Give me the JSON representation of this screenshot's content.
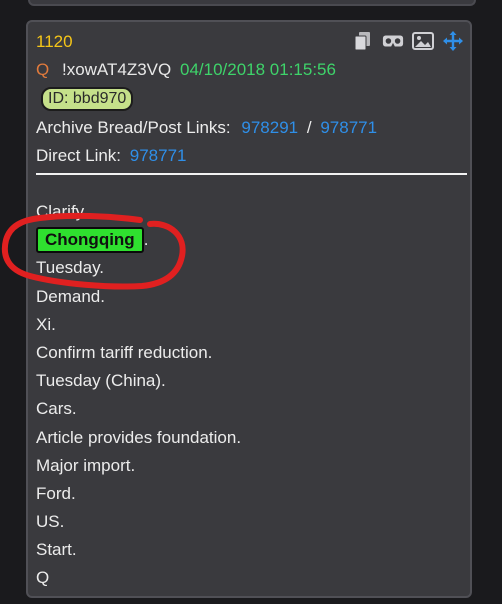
{
  "post": {
    "number": "1120",
    "q_mark": "Q",
    "tripcode": "!xowAT4Z3VQ",
    "timestamp": "04/10/2018 01:15:56",
    "id_badge": "ID: bbd970",
    "archive_label": "Archive Bread/Post Links:",
    "archive_link_1": "978291",
    "archive_sep": "/",
    "archive_link_2": "978771",
    "direct_label": "Direct Link:",
    "direct_link": "978771"
  },
  "body": {
    "lines": [
      "Clarify.",
      "Chongqing",
      "Tuesday.",
      "Demand.",
      "Xi.",
      "Confirm tariff reduction.",
      "Tuesday (China).",
      "Cars.",
      "Article provides foundation.",
      "Major import.",
      "Ford.",
      "US.",
      "Start.",
      "Q"
    ],
    "highlight_suffix": "."
  },
  "toolbar": {
    "icons": [
      "copy-icon",
      "vr-glasses-icon",
      "image-icon",
      "move-icon"
    ]
  },
  "colors": {
    "post_number": "#f5c518",
    "q_mark": "#e07a3c",
    "timestamp": "#3ed36a",
    "link": "#2f8fe8",
    "id_badge_bg": "#c5e08a",
    "highlight_bg": "#2fe02f",
    "annotation_stroke": "#e02020",
    "move_icon": "#2f8fe8"
  }
}
